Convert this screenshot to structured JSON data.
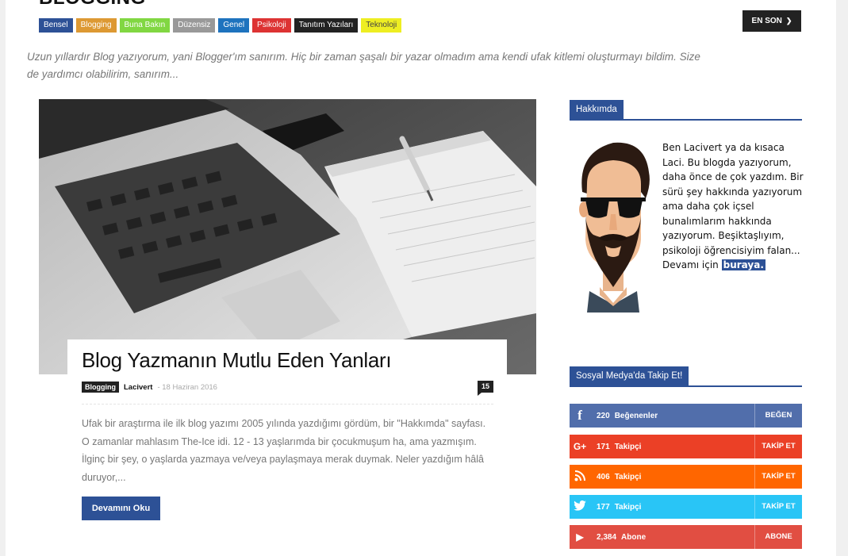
{
  "category": {
    "title": "BLOGGING"
  },
  "tags": [
    {
      "label": "Bensel",
      "color": "#2d5196"
    },
    {
      "label": "Blogging",
      "color": "#dd9933"
    },
    {
      "label": "Buna Bakın",
      "color": "#81d742"
    },
    {
      "label": "Düzensiz",
      "color": "#999999"
    },
    {
      "label": "Genel",
      "color": "#1e73be"
    },
    {
      "label": "Psikoloji",
      "color": "#dd3333"
    },
    {
      "label": "Tanıtım Yazıları",
      "color": "#222222"
    },
    {
      "label": "Teknoloji",
      "color": "#eeee22"
    }
  ],
  "sort": {
    "label": "EN SON",
    "icon": "chevron-down-icon"
  },
  "description": "Uzun yıllardır Blog yazıyorum, yani Blogger'ım sanırım. Hiç bir zaman şaşalı bir yazar olmadım ama kendi ufak kitlemi oluşturmayı bildim. Size de yardımcı olabilirim, sanırım...",
  "post": {
    "title": "Blog Yazmanın Mutlu Eden Yanları",
    "tag": "Blogging",
    "author": "Lacivert",
    "date": "- 18 Haziran 2016",
    "comments": "15",
    "excerpt": "Ufak bir araştırma ile ilk blog yazımı 2005 yılında yazdığımı gördüm, bir \"Hakkımda\" sayfası. O zamanlar mahlasım The-Ice idi. 12 - 13 yaşlarımda bir çocukmuşum ha, ama yazmışım. İlginç bir şey, o yaşlarda yazmaya ve/veya paylaşmaya merak duymak. Neler yazdığım hâlâ duruyor,...",
    "read_more": "Devamını Oku"
  },
  "about": {
    "heading": "Hakkımda",
    "text": "Ben Lacivert ya da kısaca Laci. Bu blogda yazıyorum, daha önce de çok yazdım. Bir sürü şey hakkında yazıyorum ama daha çok içsel bunalımlarım hakkında yazıyorum. Beşiktaşlıyım, psikoloji öğrencisiyim falan... Devamı için",
    "link": "buraya."
  },
  "social": {
    "heading": "Sosyal Medya'da Takip Et!",
    "items": [
      {
        "icon": "facebook-icon",
        "glyph": "f",
        "count": "220",
        "label": "Beğenenler",
        "action": "BEĞEN",
        "color": "#516eab"
      },
      {
        "icon": "google-plus-icon",
        "glyph": "G+",
        "count": "171",
        "label": "Takipçi",
        "action": "TAKİP ET",
        "color": "#eb4026"
      },
      {
        "icon": "rss-icon",
        "glyph": "◥",
        "count": "406",
        "label": "Takipçi",
        "action": "TAKİP ET",
        "color": "#ff6600"
      },
      {
        "icon": "twitter-icon",
        "glyph": "🐦",
        "count": "177",
        "label": "Takipçi",
        "action": "TAKİP ET",
        "color": "#29c5f6"
      },
      {
        "icon": "youtube-icon",
        "glyph": "▶",
        "count": "2,384",
        "label": "Abone",
        "action": "ABONE",
        "color": "#e14e42"
      }
    ]
  }
}
